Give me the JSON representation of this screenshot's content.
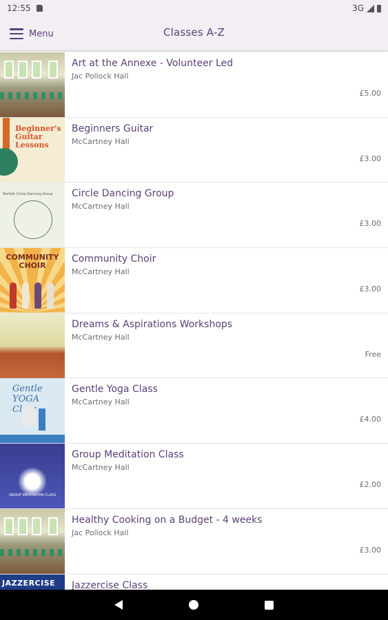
{
  "status_bar": {
    "time": "12:55",
    "network": "3G"
  },
  "app_bar": {
    "menu_label": "Menu",
    "title": "Classes A-Z"
  },
  "classes": [
    {
      "title": "Art at the Annexe - Volunteer Led",
      "venue": "Jac Pollock Hall",
      "price": "£5.00",
      "thumbnail": "hall-photo"
    },
    {
      "title": "Beginners Guitar",
      "venue": "McCartney Hall",
      "price": "£3.00",
      "thumbnail": "guitar-poster"
    },
    {
      "title": "Circle Dancing Group",
      "venue": "McCartney Hall",
      "price": "£3.00",
      "thumbnail": "circle-dance-sketch"
    },
    {
      "title": "Community Choir",
      "venue": "McCartney Hall",
      "price": "£3.00",
      "thumbnail": "choir-poster"
    },
    {
      "title": "Dreams & Aspirations Workshops",
      "venue": "McCartney Hall",
      "price": "Free",
      "thumbnail": "room-photo"
    },
    {
      "title": "Gentle Yoga Class",
      "venue": "McCartney Hall",
      "price": "£4.00",
      "thumbnail": "yoga-poster"
    },
    {
      "title": "Group Meditation Class",
      "venue": "McCartney Hall",
      "price": "£2.00",
      "thumbnail": "meditation-poster"
    },
    {
      "title": "Healthy Cooking on a Budget - 4 weeks",
      "venue": "Jac Pollock Hall",
      "price": "£3.00",
      "thumbnail": "hall-photo"
    },
    {
      "title": "Jazzercise Class",
      "venue": "",
      "price": "",
      "thumbnail": "jazzercise-poster"
    }
  ],
  "thumb_text": {
    "guitar": "Beginner's Guitar Lessons",
    "circle": "Norfolk Circle Dancing Group",
    "choir": "COMMUNITY CHOIR",
    "yoga": "Gentle YOGA Class",
    "meditation": "GROUP MEDITATION CLASS",
    "jazz": "JAZZERCISE"
  },
  "colors": {
    "accent": "#5a3f78",
    "app_bar_bg": "#f3eef4",
    "nav_bar_bg": "#000000"
  }
}
